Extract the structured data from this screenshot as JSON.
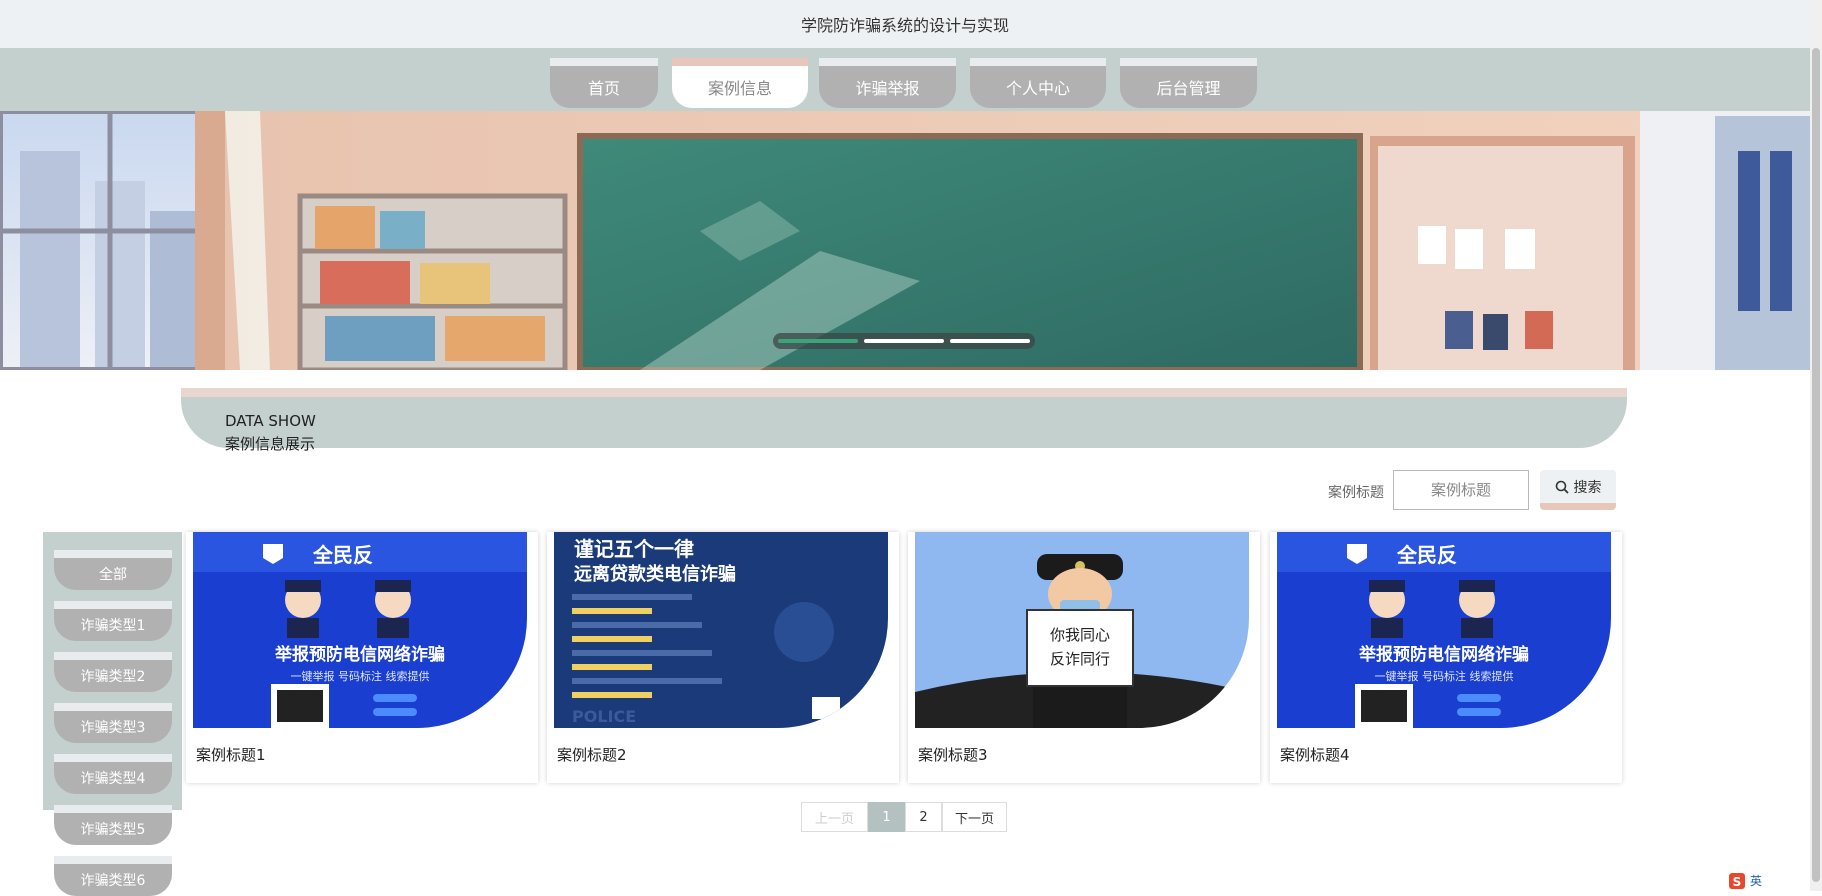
{
  "header": {
    "title": "学院防诈骗系统的设计与实现"
  },
  "nav": {
    "items": [
      {
        "label": "首页"
      },
      {
        "label": "案例信息"
      },
      {
        "label": "诈骗举报"
      },
      {
        "label": "个人中心"
      },
      {
        "label": "后台管理"
      }
    ],
    "active_index": 1
  },
  "banner": {
    "slides": 3,
    "active_slide": 1
  },
  "section": {
    "title_en": "DATA SHOW",
    "title_cn": "案例信息展示"
  },
  "search": {
    "label": "案例标题",
    "placeholder": "案例标题",
    "button_label": "搜索",
    "icon": "search-icon"
  },
  "categories": [
    {
      "label": "全部"
    },
    {
      "label": "诈骗类型1"
    },
    {
      "label": "诈骗类型2"
    },
    {
      "label": "诈骗类型3"
    },
    {
      "label": "诈骗类型4"
    },
    {
      "label": "诈骗类型5"
    },
    {
      "label": "诈骗类型6"
    }
  ],
  "cards": [
    {
      "title": "案例标题1",
      "poster": {
        "headline": "全民反",
        "main": "举报预防电信网络诈骗",
        "sub": "一键举报  号码标注  线索提供"
      }
    },
    {
      "title": "案例标题2",
      "poster": {
        "headline": "谨记五个一律",
        "main": "远离贷款类电信诈骗",
        "footer": "POLICE"
      }
    },
    {
      "title": "案例标题3",
      "poster": {
        "sign_line1": "你我同心",
        "sign_line2": "反诈同行"
      }
    },
    {
      "title": "案例标题4",
      "poster": {
        "headline": "全民反",
        "main": "举报预防电信网络诈骗",
        "sub": "一键举报  号码标注  线索提供"
      }
    }
  ],
  "pagination": {
    "prev": "上一页",
    "pages": [
      "1",
      "2"
    ],
    "current": "1",
    "next": "下一页"
  },
  "ime": {
    "label": "英"
  },
  "colors": {
    "nav_bg": "#c4d0ce",
    "tab_inactive": "#b1b1b1",
    "accent": "#e8c6b9",
    "page_active": "#b3c1c0",
    "poster_blue": "#1a3fd0"
  }
}
